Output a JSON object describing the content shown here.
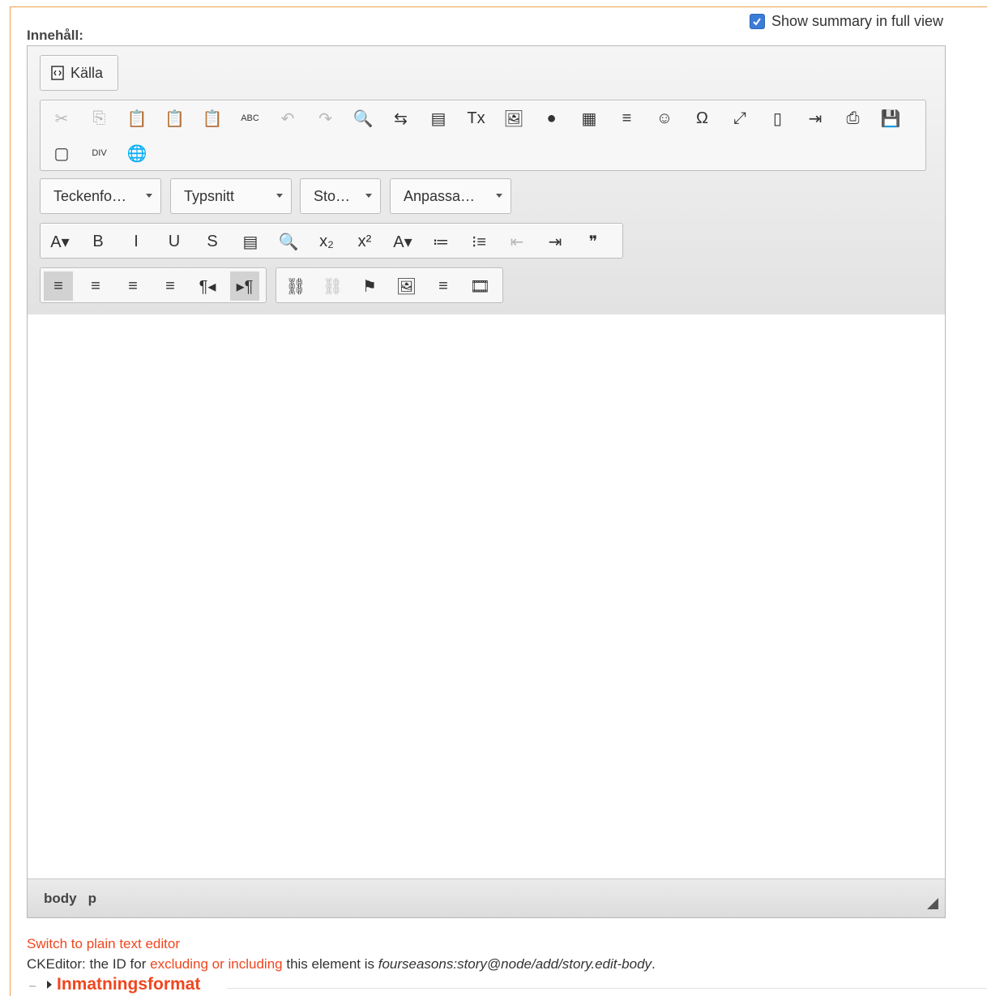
{
  "summary": {
    "label": "Show summary in full view",
    "checked": true
  },
  "field_label": "Innehåll:",
  "source_button": {
    "label": "Källa"
  },
  "toolbar_row1": [
    {
      "name": "cut-icon",
      "glyph": "✂",
      "disabled": true
    },
    {
      "name": "copy-icon",
      "glyph": "⎘",
      "disabled": true
    },
    {
      "name": "paste-icon",
      "glyph": "📋",
      "disabled": false
    },
    {
      "name": "paste-text-icon",
      "glyph": "📋",
      "disabled": false
    },
    {
      "name": "paste-from-word-icon",
      "glyph": "📋",
      "disabled": false
    },
    {
      "name": "spellcheck-icon",
      "glyph": "ABC",
      "disabled": false
    },
    {
      "name": "undo-icon",
      "glyph": "↶",
      "disabled": true
    },
    {
      "name": "redo-icon",
      "glyph": "↷",
      "disabled": true
    },
    {
      "name": "find-icon",
      "glyph": "🔍",
      "disabled": false
    },
    {
      "name": "replace-icon",
      "glyph": "⇆",
      "disabled": false
    },
    {
      "name": "select-all-icon",
      "glyph": "▤",
      "disabled": false
    },
    {
      "name": "remove-format-icon",
      "glyph": "Tx",
      "disabled": false
    },
    {
      "name": "image-icon",
      "glyph": "🖼",
      "disabled": false
    },
    {
      "name": "flash-icon",
      "glyph": "●",
      "disabled": false
    },
    {
      "name": "table-icon",
      "glyph": "▦",
      "disabled": false
    },
    {
      "name": "horizontal-line-icon",
      "glyph": "≡",
      "disabled": false
    },
    {
      "name": "smiley-icon",
      "glyph": "☺",
      "disabled": false
    },
    {
      "name": "special-char-icon",
      "glyph": "Ω",
      "disabled": false
    },
    {
      "name": "maximize-icon",
      "glyph": "⤢",
      "disabled": false
    },
    {
      "name": "show-blocks-icon",
      "glyph": "▯",
      "disabled": false
    },
    {
      "name": "page-break-icon",
      "glyph": "⇥",
      "disabled": false
    },
    {
      "name": "print-icon",
      "glyph": "⎙",
      "disabled": false
    },
    {
      "name": "save-icon",
      "glyph": "💾",
      "disabled": false
    },
    {
      "name": "new-page-icon",
      "glyph": "▢",
      "disabled": false
    },
    {
      "name": "div-container-icon",
      "glyph": "DIV",
      "disabled": false
    },
    {
      "name": "language-icon",
      "glyph": "🌐",
      "disabled": false
    }
  ],
  "combos": [
    {
      "name": "format-combo",
      "label": "Teckenfo…"
    },
    {
      "name": "font-combo",
      "label": "Typsnitt"
    },
    {
      "name": "size-combo",
      "label": "Sto…"
    },
    {
      "name": "styles-combo",
      "label": "Anpassa…"
    }
  ],
  "toolbar_row3": [
    {
      "name": "background-color-icon",
      "glyph": "A▾"
    },
    {
      "name": "bold-icon",
      "glyph": "B"
    },
    {
      "name": "italic-icon",
      "glyph": "I"
    },
    {
      "name": "underline-icon",
      "glyph": "U"
    },
    {
      "name": "strikethrough-icon",
      "glyph": "S"
    },
    {
      "name": "template-icon",
      "glyph": "▤"
    },
    {
      "name": "preview-icon",
      "glyph": "🔍"
    },
    {
      "name": "subscript-icon",
      "glyph": "x₂"
    },
    {
      "name": "superscript-icon",
      "glyph": "x²"
    },
    {
      "name": "text-color-icon",
      "glyph": "A▾"
    },
    {
      "name": "numbered-list-icon",
      "glyph": "≔"
    },
    {
      "name": "bulleted-list-icon",
      "glyph": "⁝≡"
    },
    {
      "name": "outdent-icon",
      "glyph": "⇤",
      "disabled": true
    },
    {
      "name": "indent-icon",
      "glyph": "⇥"
    },
    {
      "name": "blockquote-icon",
      "glyph": "❞"
    }
  ],
  "toolbar_row4a": [
    {
      "name": "align-left-icon",
      "glyph": "≡",
      "active": true
    },
    {
      "name": "align-center-icon",
      "glyph": "≡"
    },
    {
      "name": "align-right-icon",
      "glyph": "≡"
    },
    {
      "name": "justify-icon",
      "glyph": "≡"
    },
    {
      "name": "rtl-icon",
      "glyph": "¶◂"
    },
    {
      "name": "ltr-icon",
      "glyph": "▸¶",
      "active": true
    }
  ],
  "toolbar_row4b": [
    {
      "name": "link-icon",
      "glyph": "⛓"
    },
    {
      "name": "unlink-icon",
      "glyph": "⛓",
      "disabled": true
    },
    {
      "name": "anchor-icon",
      "glyph": "⚑"
    },
    {
      "name": "insert-image-icon",
      "glyph": "🖼"
    },
    {
      "name": "teaser-break-icon",
      "glyph": "≡"
    },
    {
      "name": "media-icon",
      "glyph": "🎞"
    }
  ],
  "elements_path": [
    "body",
    "p"
  ],
  "switch_link": "Switch to plain text editor",
  "ckinfo": {
    "prefix": "CKEditor: the ID for ",
    "link": "excluding or including",
    "middle": " this element is ",
    "id": "fourseasons:story@node/add/story.edit-body",
    "suffix": "."
  },
  "input_format": "Inmatningsformat",
  "colors": {
    "link": "#f0461e",
    "frame": "#f0a04c",
    "checkbox": "#3a7cd6"
  }
}
